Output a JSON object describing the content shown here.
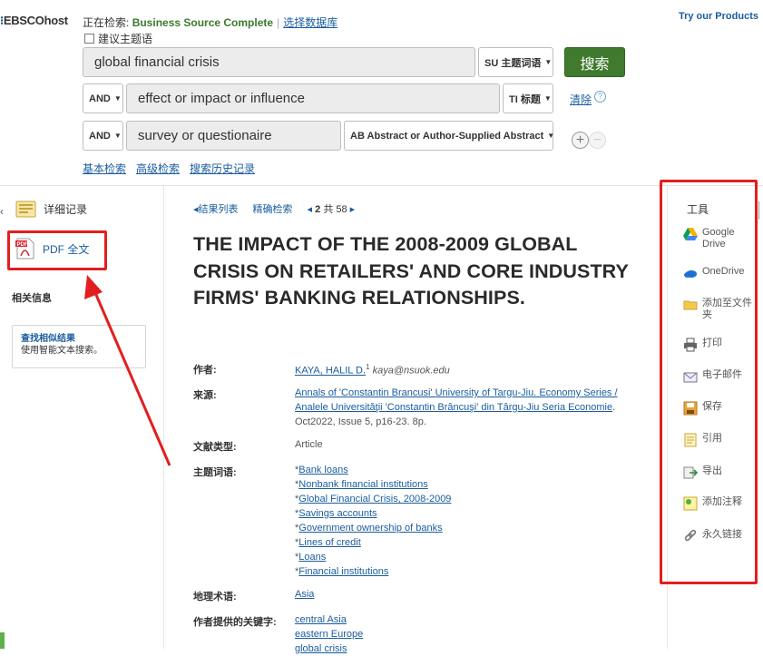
{
  "header": {
    "logo": "EBSCOhost",
    "searching_label": "正在检索:",
    "database": "Business Source Complete",
    "choose_db": "选择数据库",
    "try_products": "Try our Products",
    "suggest_label": "建议主题语"
  },
  "search": {
    "rows": [
      {
        "bool": "",
        "value": "global financial crisis",
        "field": "SU 主题词语"
      },
      {
        "bool": "AND",
        "value": "effect or impact or influence",
        "field": "TI 标题"
      },
      {
        "bool": "AND",
        "value": "survey or questionaire",
        "field": "AB Abstract or Author-Supplied Abstract"
      }
    ],
    "search_button": "搜索",
    "clear": "清除",
    "help": "?",
    "links": [
      "基本检索",
      "高级检索",
      "搜索历史记录"
    ]
  },
  "left": {
    "detail": "详细记录",
    "pdf": "PDF 全文",
    "related": "相关信息",
    "similar_title": "查找相似结果",
    "similar_sub": "使用智能文本搜索。"
  },
  "nav": {
    "result_list": "结果列表",
    "refine": "精确检索",
    "page_num": "2",
    "page_of": "共 58"
  },
  "article": {
    "title": "THE IMPACT OF THE 2008-2009 GLOBAL CRISIS ON RETAILERS' AND CORE INDUSTRY FIRMS' BANKING RELATIONSHIPS.",
    "author_label": "作者:",
    "author_name": "KAYA, HALIL D.",
    "author_sup": "1",
    "author_email": "kaya@nsuok.edu",
    "source_label": "来源:",
    "source_link1": "Annals of 'Constantin Brancusi' University of Targu-Jiu. Economy Series /",
    "source_link2": "Analele Universităţii 'Constantin Brâncuşi' din Târgu-Jiu Seria Economie",
    "source_tail": ".",
    "source_detail": "Oct2022, Issue 5, p16-23. 8p.",
    "doctype_label": "文献类型:",
    "doctype": "Article",
    "subject_label": "主题词语:",
    "subjects": [
      "Bank loans",
      "Nonbank financial institutions",
      "Global Financial Crisis, 2008-2009",
      "Savings accounts",
      "Government ownership of banks",
      "Lines of credit",
      "Loans",
      "Financial institutions"
    ],
    "geo_label": "地理术语:",
    "geo": "Asia",
    "keywords_label": "作者提供的关键字:",
    "keywords": [
      "central Asia",
      "eastern Europe",
      "global crisis"
    ]
  },
  "tools": {
    "title": "工具",
    "items": [
      {
        "label": "Google Drive",
        "icon": "google-drive-icon"
      },
      {
        "label": "OneDrive",
        "icon": "onedrive-icon"
      },
      {
        "label": "添加至文件夹",
        "icon": "folder-icon"
      },
      {
        "label": "打印",
        "icon": "printer-icon"
      },
      {
        "label": "电子邮件",
        "icon": "email-icon"
      },
      {
        "label": "保存",
        "icon": "save-icon"
      },
      {
        "label": "引用",
        "icon": "cite-icon"
      },
      {
        "label": "导出",
        "icon": "export-icon"
      },
      {
        "label": "添加注释",
        "icon": "note-icon"
      },
      {
        "label": "永久链接",
        "icon": "link-icon"
      }
    ]
  },
  "colors": {
    "annotation_red": "#e21e1e",
    "search_green": "#3f7a2e",
    "link_blue": "#1a5c9e"
  }
}
